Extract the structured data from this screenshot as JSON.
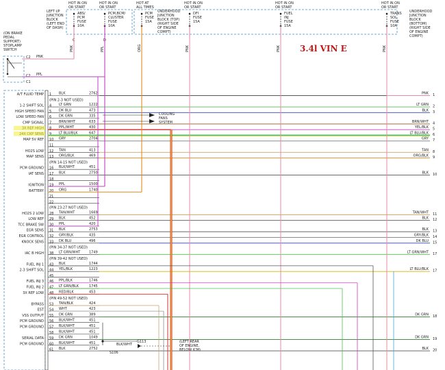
{
  "title": "3.4l VIN E",
  "top_blocks": [
    {
      "label": "LEFT I/P JUNCTION BLOCK (LEFT END OF DASH)"
    },
    {
      "label": "UNDERHOOD JUNCTION BLOCK (TOP) (RIGHT SIDE OF ENGINE COMPT)"
    },
    {
      "label": "UNDERHOOD JUNCTION BLOCK (BOTTOM) (RIGHT SIDE OF ENGINE COMPT)"
    }
  ],
  "fuses": [
    {
      "hot": "HOT IN ON OR START",
      "name": "ABS/ PCM FUSE 10A",
      "wire": "PNK",
      "pin": "C"
    },
    {
      "hot": "HOT IN ON OR START",
      "name": "PCM,BCM/ CLUSTER FUSE 10A",
      "wire": "PPL",
      "pin": "D"
    },
    {
      "hot": "HOT AT ALL TIMES",
      "name": "PCM FUSE 15A",
      "wire": "ORG",
      "pin": ""
    },
    {
      "hot": "HOT IN ON OR START",
      "name": "DFI FUSE 15A",
      "wire": "PNK",
      "pin": ""
    },
    {
      "hot": "HOT IN ON OR START",
      "name": "FUEL INJ FUSE 15A",
      "wire": "PNK",
      "pin": ""
    },
    {
      "hot": "HOT IN ON OR START",
      "name": "TRANS SOL FUSE 10A",
      "wire": "PNK",
      "pin": ""
    }
  ],
  "brake_switch": {
    "label": "(ON BRAKE PEDAL SUPPORT) STOPLAMP SWITCH",
    "pins": [
      {
        "pin": "C2",
        "wire": "PNK"
      },
      {
        "pin": "C2",
        "wire": "PPL"
      },
      {
        "pin": "C1",
        "wire": ""
      }
    ]
  },
  "pcm_pins": [
    {
      "name": "A/T FLUID TEMP",
      "pin": "1",
      "color": "BLK",
      "circuit": "2762",
      "right": "PNK",
      "rnum": "1"
    },
    {
      "name": "",
      "pin": "(PIN 2-3 NOT USED)",
      "color": "",
      "circuit": "",
      "right": "",
      "rnum": ""
    },
    {
      "name": "1-2 SHIFT SOL",
      "pin": "4",
      "color": "LT GRN",
      "circuit": "1222",
      "right": "LT GRN",
      "rnum": "2"
    },
    {
      "name": "HIGH SPEED FAN",
      "pin": "5",
      "color": "DK BLU",
      "circuit": "473",
      "right": "BLK",
      "rnum": "3"
    },
    {
      "name": "LOW SPEED FAN",
      "pin": "6",
      "color": "DK GRN",
      "circuit": "335",
      "right": "",
      "rnum": ""
    },
    {
      "name": "CMP SIGNAL",
      "pin": "7",
      "color": "BRN/WHT",
      "circuit": "633",
      "right": "BRN/WHT",
      "rnum": "4"
    },
    {
      "name": "3X REF HIGH",
      "pin": "8",
      "color": "PPL/WHT",
      "circuit": "430",
      "right": "YEL/BLK",
      "rnum": "5"
    },
    {
      "name": "24X CKP SENS",
      "pin": "9",
      "color": "LT BLU/BLK",
      "circuit": "647",
      "right": "LT BLU/BLK",
      "rnum": "6"
    },
    {
      "name": "MAP 5V REF",
      "pin": "10",
      "color": "GRY",
      "circuit": "2704",
      "right": "GRY",
      "rnum": "7"
    },
    {
      "name": "",
      "pin": "11",
      "color": "",
      "circuit": "",
      "right": "",
      "rnum": ""
    },
    {
      "name": "HO2S LOW",
      "pin": "12",
      "color": "TAN",
      "circuit": "413",
      "right": "TAN",
      "rnum": "8"
    },
    {
      "name": "MAP SENS",
      "pin": "13",
      "color": "ORG/BLK",
      "circuit": "469",
      "right": "ORG/BLK",
      "rnum": "9"
    },
    {
      "name": "",
      "pin": "(PIN 14-15 NOT USED)",
      "color": "",
      "circuit": "",
      "right": "",
      "rnum": ""
    },
    {
      "name": "PCM GROUND",
      "pin": "16",
      "color": "BLK/WHT",
      "circuit": "451",
      "right": "",
      "rnum": ""
    },
    {
      "name": "IAT SENS",
      "pin": "17",
      "color": "BLK",
      "circuit": "2750",
      "right": "BLK",
      "rnum": "10"
    },
    {
      "name": "",
      "pin": "18",
      "color": "",
      "circuit": "",
      "right": "",
      "rnum": ""
    },
    {
      "name": "IGNITION",
      "pin": "19",
      "color": "PPL",
      "circuit": "1500",
      "right": "",
      "rnum": ""
    },
    {
      "name": "BATTERY",
      "pin": "20",
      "color": "ORG",
      "circuit": "1740",
      "right": "",
      "rnum": ""
    },
    {
      "name": "",
      "pin": "21",
      "color": "",
      "circuit": "",
      "right": "",
      "rnum": ""
    },
    {
      "name": "",
      "pin": "22",
      "color": "",
      "circuit": "",
      "right": "",
      "rnum": ""
    },
    {
      "name": "",
      "pin": "(PIN 23-27 NOT USED)",
      "color": "",
      "circuit": "",
      "right": "",
      "rnum": ""
    },
    {
      "name": "HO2S 2 LOW",
      "pin": "28",
      "color": "TAN/WHT",
      "circuit": "1669",
      "right": "TAN/WHT",
      "rnum": "11"
    },
    {
      "name": "LOW REF",
      "pin": "29",
      "color": "BLK",
      "circuit": "452",
      "right": "BLK",
      "rnum": "12"
    },
    {
      "name": "TCC BRAKE SW",
      "pin": "30",
      "color": "PPL",
      "circuit": "420",
      "right": "",
      "rnum": ""
    },
    {
      "name": "EGR SENS",
      "pin": "31",
      "color": "BLK",
      "circuit": "2753",
      "right": "BLK",
      "rnum": "13"
    },
    {
      "name": "EGR CONTROL",
      "pin": "32",
      "color": "GRY/BLK",
      "circuit": "435",
      "right": "GRY/BLK",
      "rnum": "14"
    },
    {
      "name": "KNOCK SENS",
      "pin": "33",
      "color": "DK BLU",
      "circuit": "496",
      "right": "DK BLU",
      "rnum": "15"
    },
    {
      "name": "",
      "pin": "(PIN 34-37 NOT USED)",
      "color": "",
      "circuit": "",
      "right": "",
      "rnum": ""
    },
    {
      "name": "IAC B HIGH",
      "pin": "38",
      "color": "LT GRN/WHT",
      "circuit": "1749",
      "right": "LT GRN/WHT",
      "rnum": "17"
    },
    {
      "name": "",
      "pin": "(PIN 39-42 NOT USED)",
      "color": "",
      "circuit": "",
      "right": "",
      "rnum": ""
    },
    {
      "name": "FUEL INJ 1",
      "pin": "43",
      "color": "BLK",
      "circuit": "1744",
      "right": "",
      "rnum": ""
    },
    {
      "name": "2-3 SHIFT SOL",
      "pin": "44",
      "color": "YEL/BLK",
      "circuit": "1223",
      "right": "LT BLU/BLK",
      "rnum": "17"
    },
    {
      "name": "",
      "pin": "45",
      "color": "",
      "circuit": "",
      "right": "",
      "rnum": ""
    },
    {
      "name": "FUEL INJ 3",
      "pin": "46",
      "color": "PPL/BLK",
      "circuit": "1746",
      "right": "",
      "rnum": ""
    },
    {
      "name": "FUEL INJ 2",
      "pin": "47",
      "color": "LT GRN/BLK",
      "circuit": "1745",
      "right": "",
      "rnum": ""
    },
    {
      "name": "3X REF LOW",
      "pin": "48",
      "color": "RED/BLK",
      "circuit": "453",
      "right": "",
      "rnum": ""
    },
    {
      "name": "",
      "pin": "(PIN 49-52 NOT USED)",
      "color": "",
      "circuit": "",
      "right": "",
      "rnum": ""
    },
    {
      "name": "BYPASS",
      "pin": "53",
      "color": "TAN/BLK",
      "circuit": "424",
      "right": "",
      "rnum": ""
    },
    {
      "name": "EST",
      "pin": "54",
      "color": "WHT",
      "circuit": "423",
      "right": "",
      "rnum": ""
    },
    {
      "name": "VSS OUTPUT",
      "pin": "55",
      "color": "DK GRN",
      "circuit": "389",
      "right": "DK GRN",
      "rnum": "18"
    },
    {
      "name": "PCM GROUND",
      "pin": "56",
      "color": "BLK/WHT",
      "circuit": "451",
      "right": "",
      "rnum": ""
    },
    {
      "name": "PCM GROUND",
      "pin": "57",
      "color": "BLK/WHT",
      "circuit": "451",
      "right": "",
      "rnum": ""
    },
    {
      "name": "",
      "pin": "58",
      "color": "BLK/WHT",
      "circuit": "451",
      "right": "",
      "rnum": ""
    },
    {
      "name": "SERIAL DATA",
      "pin": "59",
      "color": "DK GRN",
      "circuit": "1049",
      "right": "DK GRN",
      "rnum": "19"
    },
    {
      "name": "PCM GROUND",
      "pin": "60",
      "color": "BLK/WHT",
      "circuit": "451",
      "right": "",
      "rnum": ""
    },
    {
      "name": "",
      "pin": "61",
      "color": "BLK",
      "circuit": "2752",
      "right": "BLK",
      "rnum": "20"
    }
  ],
  "cooling_fans": "COOLING FANS SYSTEM",
  "ground": {
    "splice": "S106",
    "wire": "BLK/WHT",
    "id": "G113",
    "label": "(LEFT REAR OF ENGINE, BELOW ICM)"
  }
}
